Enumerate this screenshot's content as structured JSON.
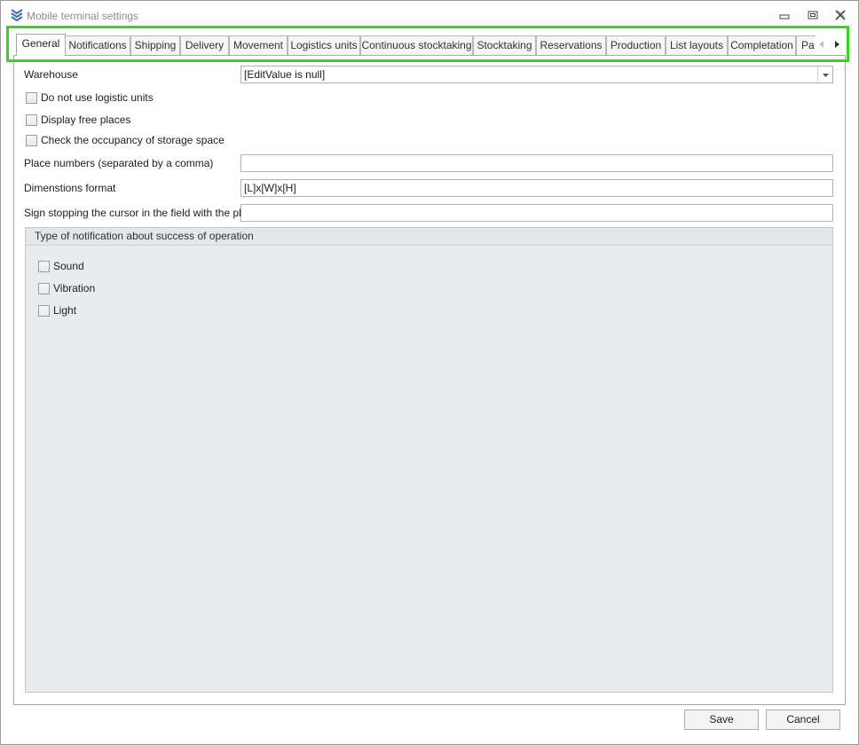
{
  "window": {
    "title": "Mobile terminal settings"
  },
  "tabs": [
    {
      "label": "General",
      "active": true
    },
    {
      "label": "Notifications"
    },
    {
      "label": "Shipping"
    },
    {
      "label": "Delivery"
    },
    {
      "label": "Movement"
    },
    {
      "label": "Logistics units"
    },
    {
      "label": "Continuous stocktaking"
    },
    {
      "label": "Stocktaking"
    },
    {
      "label": "Reservations"
    },
    {
      "label": "Production"
    },
    {
      "label": "List layouts"
    },
    {
      "label": "Completation"
    },
    {
      "label": "Pa"
    }
  ],
  "form": {
    "warehouse_label": "Warehouse",
    "warehouse_value": "[EditValue is null]",
    "no_logistic_units_label": "Do not use logistic units",
    "display_free_places_label": "Display free places",
    "check_occupancy_label": "Check the occupancy of storage space",
    "place_numbers_label": "Place numbers (separated by a comma)",
    "place_numbers_value": "",
    "dimensions_format_label": "Dimenstions format",
    "dimensions_format_value": "[L]x[W]x[H]",
    "sign_stopping_label": "Sign stopping the cursor in the field with the place",
    "sign_stopping_value": ""
  },
  "notification_group": {
    "title": "Type of notification about success of operation",
    "sound_label": "Sound",
    "vibration_label": "Vibration",
    "light_label": "Light"
  },
  "buttons": {
    "save": "Save",
    "cancel": "Cancel"
  },
  "colors": {
    "highlight": "#37d51d",
    "group_background": "#e9ecef",
    "icon_blue": "#3b6fb6"
  }
}
